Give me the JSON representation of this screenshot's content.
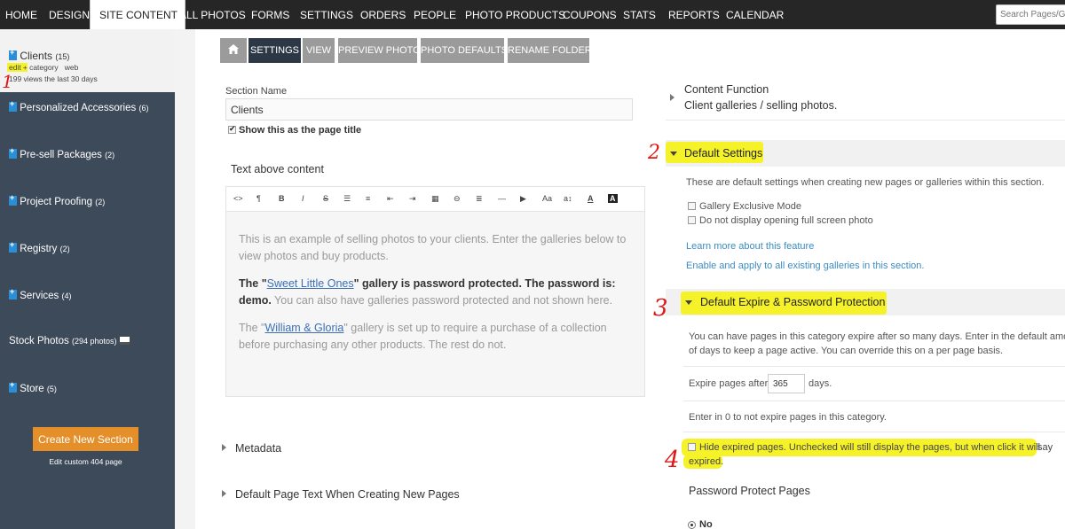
{
  "nav": {
    "items": [
      "HOME",
      "DESIGN",
      "SITE CONTENT",
      "ALL PHOTOS",
      "FORMS",
      "SETTINGS",
      "ORDERS",
      "PEOPLE",
      "PHOTO PRODUCTS",
      "COUPONS",
      "STATS",
      "REPORTS",
      "CALENDAR"
    ],
    "active": "SITE CONTENT",
    "search_placeholder": "Search Pages/Ga"
  },
  "sidebar": {
    "current": {
      "name": "Clients",
      "count": "(15)",
      "links": [
        "edit",
        "+",
        "category",
        "web"
      ],
      "views": "199 views the last 30 days"
    },
    "items": [
      {
        "label": "Personalized Accessories",
        "count": "(6)"
      },
      {
        "label": "Pre-sell Packages",
        "count": "(2)"
      },
      {
        "label": "Project Proofing",
        "count": "(2)"
      },
      {
        "label": "Registry",
        "count": "(2)"
      },
      {
        "label": "Services",
        "count": "(4)"
      },
      {
        "label": "Stock Photos",
        "count": "(294 photos)"
      },
      {
        "label": "Store",
        "count": "(5)"
      }
    ],
    "create_button": "Create New Section",
    "edit_404": "Edit custom 404 page"
  },
  "tabs": [
    {
      "label": "home-icon"
    },
    {
      "label": "SETTINGS"
    },
    {
      "label": "VIEW"
    },
    {
      "label": "PREVIEW PHOTO"
    },
    {
      "label": "PHOTO DEFAULTS"
    },
    {
      "label": "RENAME FOLDER"
    }
  ],
  "form": {
    "section_name_label": "Section Name",
    "section_name_value": "Clients",
    "show_title_label": "Show this as the page title",
    "text_above_label": "Text above content",
    "editor": {
      "toolbar": [
        "<>",
        "¶",
        "B",
        "I",
        "S",
        "☰",
        "≡",
        "⇤",
        "⇥",
        "▦",
        "⊖",
        "≣",
        "—",
        "▶",
        "Aa",
        "a↕",
        "A",
        "A"
      ],
      "p1": "This is an example of selling photos to your clients. Enter the galleries below to view photos and buy products.",
      "p2_prefix": "The \"",
      "p2_link": "Sweet Little Ones",
      "p2_bold": "\" gallery is password protected. The password is: demo.",
      "p2_rest": " You can also have galleries password protected and not shown here.",
      "p3_prefix": "The \"",
      "p3_link": "William & Gloria",
      "p3_rest": "\" gallery is set up to require a purchase of a collection before purchasing any other products. The rest do not."
    },
    "metadata": "Metadata",
    "default_page_text": "Default Page Text When Creating New Pages"
  },
  "right": {
    "content_function_title": "Content Function",
    "content_function_value": "Client galleries / selling photos.",
    "default_settings_title": "Default Settings",
    "default_settings_desc": "These are default settings when creating new pages or galleries within this section.",
    "gallery_exclusive": "Gallery Exclusive Mode",
    "no_fullscreen": "Do not display opening full screen photo",
    "learn_more": "Learn more about this feature",
    "enable_apply": "Enable and apply to all existing galleries in this section.",
    "expire_title": "Default Expire & Password Protection",
    "expire_desc1": "You can have pages in this category expire after so many days. Enter in the default amou",
    "expire_desc2": "of days to keep a page active. You can override this on a per page basis.",
    "expire_label": "Expire pages after",
    "expire_value": "365",
    "expire_unit": "days.",
    "expire_zero": "Enter in 0 to not expire pages in this category.",
    "hide_expired_1": "Hide expired pages. Unchecked will still display the pages, but when click it will",
    "hide_expired_say": "say",
    "hide_expired_2": "expired.",
    "password_title": "Password Protect Pages",
    "password_no": "No"
  },
  "annotations": [
    "1",
    "2",
    "3",
    "4"
  ],
  "colors": {
    "nav_bg": "#262626",
    "sidebar_bg": "#3d4a5a",
    "accent_orange": "#e48f2a",
    "link_blue": "#3a8cc2",
    "tab_active": "#2d3846",
    "tab_inactive": "#9b9b9b",
    "highlight": "#f6f22a",
    "annotation_red": "#e01515"
  }
}
